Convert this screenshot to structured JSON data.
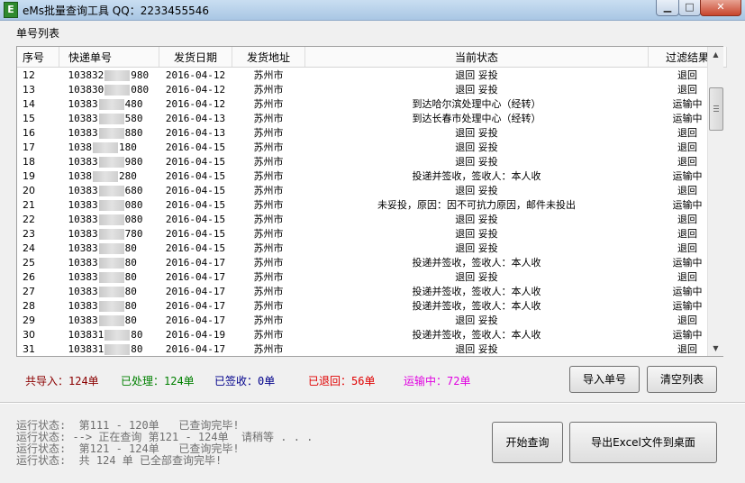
{
  "window": {
    "title": "eMs批量查询工具 QQ：2233455546",
    "icon_letter": "E"
  },
  "group_label": "单号列表",
  "columns": [
    "序号",
    "快递单号",
    "发货日期",
    "发货地址",
    "当前状态",
    "过滤结果"
  ],
  "rows": [
    {
      "seq": "12",
      "no_prefix": "103832",
      "no_suffix": "980",
      "date": "2016-04-12",
      "addr": "苏州市",
      "status": "退回 妥投",
      "result": "退回"
    },
    {
      "seq": "13",
      "no_prefix": "103830",
      "no_suffix": "080",
      "date": "2016-04-12",
      "addr": "苏州市",
      "status": "退回 妥投",
      "result": "退回"
    },
    {
      "seq": "14",
      "no_prefix": "10383",
      "no_suffix": "480",
      "date": "2016-04-12",
      "addr": "苏州市",
      "status": "到达哈尔滨处理中心（经转）",
      "result": "运输中"
    },
    {
      "seq": "15",
      "no_prefix": "10383",
      "no_suffix": "580",
      "date": "2016-04-13",
      "addr": "苏州市",
      "status": "到达长春市处理中心（经转）",
      "result": "运输中"
    },
    {
      "seq": "16",
      "no_prefix": "10383",
      "no_suffix": "880",
      "date": "2016-04-13",
      "addr": "苏州市",
      "status": "退回 妥投",
      "result": "退回"
    },
    {
      "seq": "17",
      "no_prefix": "1038",
      "no_suffix": "180",
      "date": "2016-04-15",
      "addr": "苏州市",
      "status": "退回 妥投",
      "result": "退回"
    },
    {
      "seq": "18",
      "no_prefix": "10383",
      "no_suffix": "980",
      "date": "2016-04-15",
      "addr": "苏州市",
      "status": "退回 妥投",
      "result": "退回"
    },
    {
      "seq": "19",
      "no_prefix": "1038",
      "no_suffix": "280",
      "date": "2016-04-15",
      "addr": "苏州市",
      "status": "投递并签收，签收人：本人收",
      "result": "运输中"
    },
    {
      "seq": "20",
      "no_prefix": "10383",
      "no_suffix": "680",
      "date": "2016-04-15",
      "addr": "苏州市",
      "status": "退回 妥投",
      "result": "退回"
    },
    {
      "seq": "21",
      "no_prefix": "10383",
      "no_suffix": "080",
      "date": "2016-04-15",
      "addr": "苏州市",
      "status": "未妥投，原因：因不可抗力原因，邮件未投出",
      "result": "运输中"
    },
    {
      "seq": "22",
      "no_prefix": "10383",
      "no_suffix": "080",
      "date": "2016-04-15",
      "addr": "苏州市",
      "status": "退回 妥投",
      "result": "退回"
    },
    {
      "seq": "23",
      "no_prefix": "10383",
      "no_suffix": "780",
      "date": "2016-04-15",
      "addr": "苏州市",
      "status": "退回 妥投",
      "result": "退回"
    },
    {
      "seq": "24",
      "no_prefix": "10383",
      "no_suffix": "80",
      "date": "2016-04-15",
      "addr": "苏州市",
      "status": "退回 妥投",
      "result": "退回"
    },
    {
      "seq": "25",
      "no_prefix": "10383",
      "no_suffix": "80",
      "date": "2016-04-17",
      "addr": "苏州市",
      "status": "投递并签收，签收人：本人收",
      "result": "运输中"
    },
    {
      "seq": "26",
      "no_prefix": "10383",
      "no_suffix": "80",
      "date": "2016-04-17",
      "addr": "苏州市",
      "status": "退回 妥投",
      "result": "退回"
    },
    {
      "seq": "27",
      "no_prefix": "10383",
      "no_suffix": "80",
      "date": "2016-04-17",
      "addr": "苏州市",
      "status": "投递并签收，签收人：本人收",
      "result": "运输中"
    },
    {
      "seq": "28",
      "no_prefix": "10383",
      "no_suffix": "80",
      "date": "2016-04-17",
      "addr": "苏州市",
      "status": "投递并签收，签收人：本人收",
      "result": "运输中"
    },
    {
      "seq": "29",
      "no_prefix": "10383",
      "no_suffix": "80",
      "date": "2016-04-17",
      "addr": "苏州市",
      "status": "退回 妥投",
      "result": "退回"
    },
    {
      "seq": "30",
      "no_prefix": "103831",
      "no_suffix": "80",
      "date": "2016-04-19",
      "addr": "苏州市",
      "status": "投递并签收，签收人：本人收",
      "result": "运输中"
    },
    {
      "seq": "31",
      "no_prefix": "103831",
      "no_suffix": "80",
      "date": "2016-04-17",
      "addr": "苏州市",
      "status": "退回 妥投",
      "result": "退回"
    }
  ],
  "stats": {
    "imported": "共导入：124单",
    "processed": "已处理：124单",
    "signed": "已签收：0单",
    "returned": "已退回：56单",
    "in_transit": "运输中：72单"
  },
  "colors": {
    "imported": "#8b0000",
    "processed": "#008000",
    "signed": "#00008b",
    "returned": "#e00000",
    "in_transit": "#e000e0"
  },
  "buttons": {
    "import": "导入单号",
    "clear": "清空列表",
    "start": "开始查询",
    "export": "导出Excel文件到桌面"
  },
  "log_lines": [
    "运行状态:  第111 - 120单   已查询完毕!",
    "运行状态: --> 正在查询 第121 - 124单  请稍等 . . .",
    "运行状态:  第121 - 124单   已查询完毕!",
    "运行状态:  共 124 单 已全部查询完毕!"
  ]
}
